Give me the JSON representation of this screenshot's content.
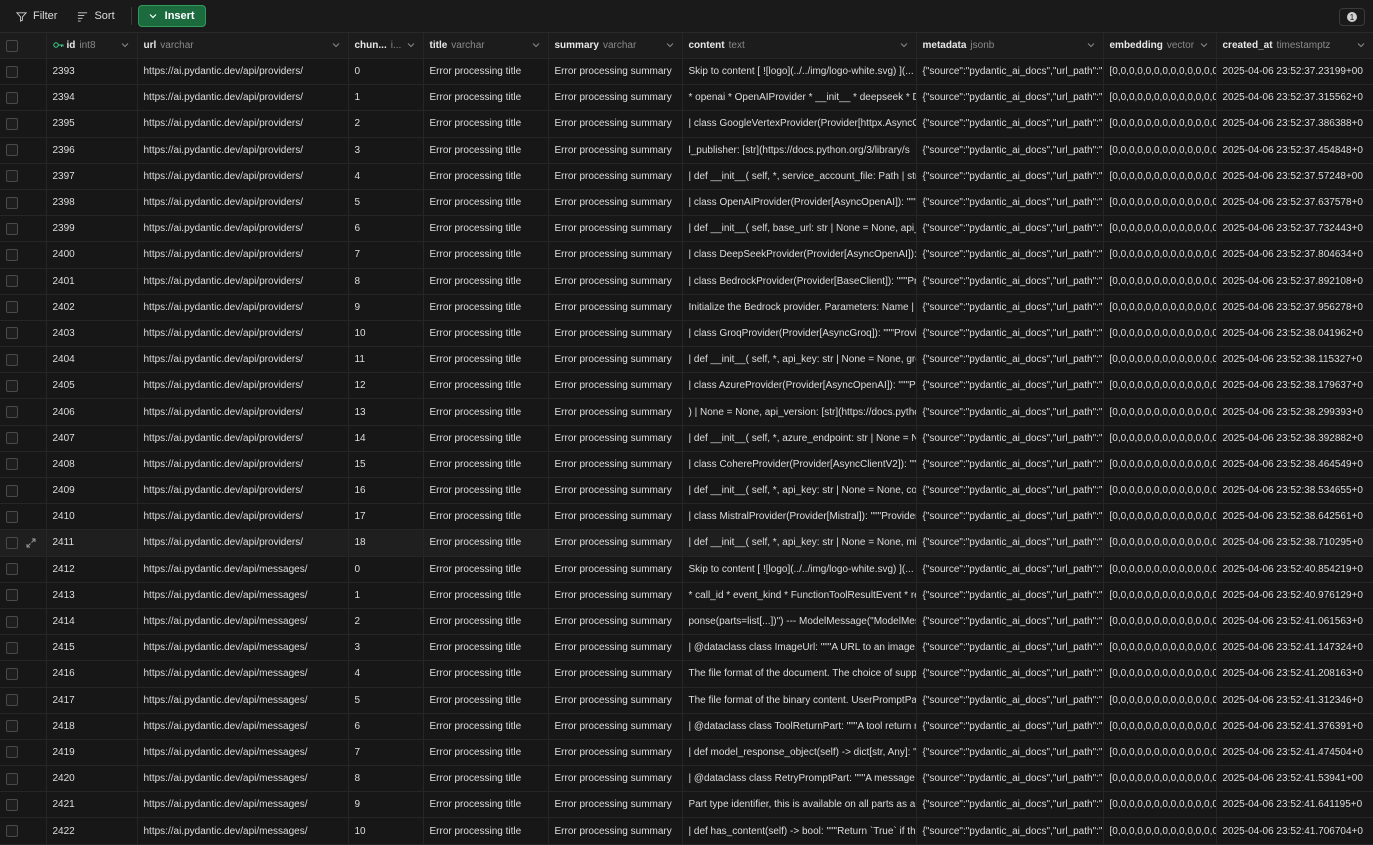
{
  "toolbar": {
    "filter_label": "Filter",
    "sort_label": "Sort",
    "insert_label": "Insert",
    "badge_count": "1"
  },
  "columns": [
    {
      "name": "id",
      "type": "int8"
    },
    {
      "name": "url",
      "type": "varchar"
    },
    {
      "name": "chun...",
      "type": "i..."
    },
    {
      "name": "title",
      "type": "varchar"
    },
    {
      "name": "summary",
      "type": "varchar"
    },
    {
      "name": "content",
      "type": "text"
    },
    {
      "name": "metadata",
      "type": "jsonb"
    },
    {
      "name": "embedding",
      "type": "vector"
    },
    {
      "name": "created_at",
      "type": "timestamptz"
    }
  ],
  "rows": [
    {
      "id": "2393",
      "url": "https://ai.pydantic.dev/api/providers/",
      "chunk": "0",
      "title": "Error processing title",
      "summary": "Error processing summary",
      "content": "Skip to content [ ![logo](../../img/logo-white.svg) ](...",
      "metadata": "{\"source\":\"pydantic_ai_docs\",\"url_path\":\"",
      "embedding": "[0,0,0,0,0,0,0,0,0,0,0,0,0,0,0",
      "created_at": "2025-04-06 23:52:37.23199+00"
    },
    {
      "id": "2394",
      "url": "https://ai.pydantic.dev/api/providers/",
      "chunk": "1",
      "title": "Error processing title",
      "summary": "Error processing summary",
      "content": "* openai * OpenAIProvider * __init__ * deepseek * D",
      "metadata": "{\"source\":\"pydantic_ai_docs\",\"url_path\":\"",
      "embedding": "[0,0,0,0,0,0,0,0,0,0,0,0,0,0,0",
      "created_at": "2025-04-06 23:52:37.315562+0"
    },
    {
      "id": "2395",
      "url": "https://ai.pydantic.dev/api/providers/",
      "chunk": "2",
      "title": "Error processing title",
      "summary": "Error processing summary",
      "content": "| class GoogleVertexProvider(Provider[httpx.AsyncC",
      "metadata": "{\"source\":\"pydantic_ai_docs\",\"url_path\":\"",
      "embedding": "[0,0,0,0,0,0,0,0,0,0,0,0,0,0,0",
      "created_at": "2025-04-06 23:52:37.386388+0"
    },
    {
      "id": "2396",
      "url": "https://ai.pydantic.dev/api/providers/",
      "chunk": "3",
      "title": "Error processing title",
      "summary": "Error processing summary",
      "content": "l_publisher: [str](https://docs.python.org/3/library/s",
      "metadata": "{\"source\":\"pydantic_ai_docs\",\"url_path\":\"",
      "embedding": "[0,0,0,0,0,0,0,0,0,0,0,0,0,0,0",
      "created_at": "2025-04-06 23:52:37.454848+0"
    },
    {
      "id": "2397",
      "url": "https://ai.pydantic.dev/api/providers/",
      "chunk": "4",
      "title": "Error processing title",
      "summary": "Error processing summary",
      "content": "| def __init__( self, *, service_account_file: Path | str",
      "metadata": "{\"source\":\"pydantic_ai_docs\",\"url_path\":\"",
      "embedding": "[0,0,0,0,0,0,0,0,0,0,0,0,0,0,0",
      "created_at": "2025-04-06 23:52:37.57248+00"
    },
    {
      "id": "2398",
      "url": "https://ai.pydantic.dev/api/providers/",
      "chunk": "5",
      "title": "Error processing title",
      "summary": "Error processing summary",
      "content": "| class OpenAIProvider(Provider[AsyncOpenAI]): \"\"\"P",
      "metadata": "{\"source\":\"pydantic_ai_docs\",\"url_path\":\"",
      "embedding": "[0,0,0,0,0,0,0,0,0,0,0,0,0,0,0",
      "created_at": "2025-04-06 23:52:37.637578+0"
    },
    {
      "id": "2399",
      "url": "https://ai.pydantic.dev/api/providers/",
      "chunk": "6",
      "title": "Error processing title",
      "summary": "Error processing summary",
      "content": "| def __init__( self, base_url: str | None = None, api_",
      "metadata": "{\"source\":\"pydantic_ai_docs\",\"url_path\":\"",
      "embedding": "[0,0,0,0,0,0,0,0,0,0,0,0,0,0,0",
      "created_at": "2025-04-06 23:52:37.732443+0"
    },
    {
      "id": "2400",
      "url": "https://ai.pydantic.dev/api/providers/",
      "chunk": "7",
      "title": "Error processing title",
      "summary": "Error processing summary",
      "content": "| class DeepSeekProvider(Provider[AsyncOpenAI]): \"",
      "metadata": "{\"source\":\"pydantic_ai_docs\",\"url_path\":\"",
      "embedding": "[0,0,0,0,0,0,0,0,0,0,0,0,0,0,0",
      "created_at": "2025-04-06 23:52:37.804634+0"
    },
    {
      "id": "2401",
      "url": "https://ai.pydantic.dev/api/providers/",
      "chunk": "8",
      "title": "Error processing title",
      "summary": "Error processing summary",
      "content": "| class BedrockProvider(Provider[BaseClient]): \"\"\"Pro",
      "metadata": "{\"source\":\"pydantic_ai_docs\",\"url_path\":\"",
      "embedding": "[0,0,0,0,0,0,0,0,0,0,0,0,0,0,0",
      "created_at": "2025-04-06 23:52:37.892108+0"
    },
    {
      "id": "2402",
      "url": "https://ai.pydantic.dev/api/providers/",
      "chunk": "9",
      "title": "Error processing title",
      "summary": "Error processing summary",
      "content": "Initialize the Bedrock provider. Parameters: Name | T",
      "metadata": "{\"source\":\"pydantic_ai_docs\",\"url_path\":\"",
      "embedding": "[0,0,0,0,0,0,0,0,0,0,0,0,0,0,0",
      "created_at": "2025-04-06 23:52:37.956278+0"
    },
    {
      "id": "2403",
      "url": "https://ai.pydantic.dev/api/providers/",
      "chunk": "10",
      "title": "Error processing title",
      "summary": "Error processing summary",
      "content": "| class GroqProvider(Provider[AsyncGroq]): \"\"\"Provic",
      "metadata": "{\"source\":\"pydantic_ai_docs\",\"url_path\":\"",
      "embedding": "[0,0,0,0,0,0,0,0,0,0,0,0,0,0,0",
      "created_at": "2025-04-06 23:52:38.041962+0"
    },
    {
      "id": "2404",
      "url": "https://ai.pydantic.dev/api/providers/",
      "chunk": "11",
      "title": "Error processing title",
      "summary": "Error processing summary",
      "content": "| def __init__( self, *, api_key: str | None = None, gro",
      "metadata": "{\"source\":\"pydantic_ai_docs\",\"url_path\":\"",
      "embedding": "[0,0,0,0,0,0,0,0,0,0,0,0,0,0,0",
      "created_at": "2025-04-06 23:52:38.115327+0"
    },
    {
      "id": "2405",
      "url": "https://ai.pydantic.dev/api/providers/",
      "chunk": "12",
      "title": "Error processing title",
      "summary": "Error processing summary",
      "content": "| class AzureProvider(Provider[AsyncOpenAI]): \"\"\"Pro",
      "metadata": "{\"source\":\"pydantic_ai_docs\",\"url_path\":\"",
      "embedding": "[0,0,0,0,0,0,0,0,0,0,0,0,0,0,0",
      "created_at": "2025-04-06 23:52:38.179637+0"
    },
    {
      "id": "2406",
      "url": "https://ai.pydantic.dev/api/providers/",
      "chunk": "13",
      "title": "Error processing title",
      "summary": "Error processing summary",
      "content": ") | None = None, api_version: [str](https://docs.pytho",
      "metadata": "{\"source\":\"pydantic_ai_docs\",\"url_path\":\"",
      "embedding": "[0,0,0,0,0,0,0,0,0,0,0,0,0,0,0",
      "created_at": "2025-04-06 23:52:38.299393+0"
    },
    {
      "id": "2407",
      "url": "https://ai.pydantic.dev/api/providers/",
      "chunk": "14",
      "title": "Error processing title",
      "summary": "Error processing summary",
      "content": "| def __init__( self, *, azure_endpoint: str | None = N",
      "metadata": "{\"source\":\"pydantic_ai_docs\",\"url_path\":\"",
      "embedding": "[0,0,0,0,0,0,0,0,0,0,0,0,0,0,0",
      "created_at": "2025-04-06 23:52:38.392882+0"
    },
    {
      "id": "2408",
      "url": "https://ai.pydantic.dev/api/providers/",
      "chunk": "15",
      "title": "Error processing title",
      "summary": "Error processing summary",
      "content": "| class CohereProvider(Provider[AsyncClientV2]): \"\"\"",
      "metadata": "{\"source\":\"pydantic_ai_docs\",\"url_path\":\"",
      "embedding": "[0,0,0,0,0,0,0,0,0,0,0,0,0,0,0",
      "created_at": "2025-04-06 23:52:38.464549+0"
    },
    {
      "id": "2409",
      "url": "https://ai.pydantic.dev/api/providers/",
      "chunk": "16",
      "title": "Error processing title",
      "summary": "Error processing summary",
      "content": "| def __init__( self, *, api_key: str | None = None, coh",
      "metadata": "{\"source\":\"pydantic_ai_docs\",\"url_path\":\"",
      "embedding": "[0,0,0,0,0,0,0,0,0,0,0,0,0,0,0",
      "created_at": "2025-04-06 23:52:38.534655+0"
    },
    {
      "id": "2410",
      "url": "https://ai.pydantic.dev/api/providers/",
      "chunk": "17",
      "title": "Error processing title",
      "summary": "Error processing summary",
      "content": "| class MistralProvider(Provider[Mistral]): \"\"\"Provider",
      "metadata": "{\"source\":\"pydantic_ai_docs\",\"url_path\":\"",
      "embedding": "[0,0,0,0,0,0,0,0,0,0,0,0,0,0,0",
      "created_at": "2025-04-06 23:52:38.642561+0"
    },
    {
      "id": "2411",
      "url": "https://ai.pydantic.dev/api/providers/",
      "chunk": "18",
      "title": "Error processing title",
      "summary": "Error processing summary",
      "content": "| def __init__( self, *, api_key: str | None = None, mis",
      "metadata": "{\"source\":\"pydantic_ai_docs\",\"url_path\":\"",
      "embedding": "[0,0,0,0,0,0,0,0,0,0,0,0,0,0,0",
      "created_at": "2025-04-06 23:52:38.710295+0"
    },
    {
      "id": "2412",
      "url": "https://ai.pydantic.dev/api/messages/",
      "chunk": "0",
      "title": "Error processing title",
      "summary": "Error processing summary",
      "content": "Skip to content [ ![logo](../../img/logo-white.svg) ](...",
      "metadata": "{\"source\":\"pydantic_ai_docs\",\"url_path\":\"",
      "embedding": "[0,0,0,0,0,0,0,0,0,0,0,0,0,0,0",
      "created_at": "2025-04-06 23:52:40.854219+0"
    },
    {
      "id": "2413",
      "url": "https://ai.pydantic.dev/api/messages/",
      "chunk": "1",
      "title": "Error processing title",
      "summary": "Error processing summary",
      "content": "* call_id * event_kind * FunctionToolResultEvent * re",
      "metadata": "{\"source\":\"pydantic_ai_docs\",\"url_path\":\"",
      "embedding": "[0,0,0,0,0,0,0,0,0,0,0,0,0,0,0",
      "created_at": "2025-04-06 23:52:40.976129+0"
    },
    {
      "id": "2414",
      "url": "https://ai.pydantic.dev/api/messages/",
      "chunk": "2",
      "title": "Error processing title",
      "summary": "Error processing summary",
      "content": "ponse(parts=list[...])\") --- ModelMessage(\"ModelMes",
      "metadata": "{\"source\":\"pydantic_ai_docs\",\"url_path\":\"",
      "embedding": "[0,0,0,0,0,0,0,0,0,0,0,0,0,0,0",
      "created_at": "2025-04-06 23:52:41.061563+0"
    },
    {
      "id": "2415",
      "url": "https://ai.pydantic.dev/api/messages/",
      "chunk": "3",
      "title": "Error processing title",
      "summary": "Error processing summary",
      "content": "| @dataclass class ImageUrl: \"\"\"A URL to an image.\"",
      "metadata": "{\"source\":\"pydantic_ai_docs\",\"url_path\":\"",
      "embedding": "[0,0,0,0,0,0,0,0,0,0,0,0,0,0,0",
      "created_at": "2025-04-06 23:52:41.147324+0"
    },
    {
      "id": "2416",
      "url": "https://ai.pydantic.dev/api/messages/",
      "chunk": "4",
      "title": "Error processing title",
      "summary": "Error processing summary",
      "content": "The file format of the document. The choice of supp",
      "metadata": "{\"source\":\"pydantic_ai_docs\",\"url_path\":\"",
      "embedding": "[0,0,0,0,0,0,0,0,0,0,0,0,0,0,0",
      "created_at": "2025-04-06 23:52:41.208163+0"
    },
    {
      "id": "2417",
      "url": "https://ai.pydantic.dev/api/messages/",
      "chunk": "5",
      "title": "Error processing title",
      "summary": "Error processing summary",
      "content": "The file format of the binary content. UserPromptPa",
      "metadata": "{\"source\":\"pydantic_ai_docs\",\"url_path\":\"",
      "embedding": "[0,0,0,0,0,0,0,0,0,0,0,0,0,0,0",
      "created_at": "2025-04-06 23:52:41.312346+0"
    },
    {
      "id": "2418",
      "url": "https://ai.pydantic.dev/api/messages/",
      "chunk": "6",
      "title": "Error processing title",
      "summary": "Error processing summary",
      "content": "| @dataclass class ToolReturnPart: \"\"\"A tool return m",
      "metadata": "{\"source\":\"pydantic_ai_docs\",\"url_path\":\"",
      "embedding": "[0,0,0,0,0,0,0,0,0,0,0,0,0,0,0",
      "created_at": "2025-04-06 23:52:41.376391+0"
    },
    {
      "id": "2419",
      "url": "https://ai.pydantic.dev/api/messages/",
      "chunk": "7",
      "title": "Error processing title",
      "summary": "Error processing summary",
      "content": "| def model_response_object(self) -> dict[str, Any]: \"",
      "metadata": "{\"source\":\"pydantic_ai_docs\",\"url_path\":\"",
      "embedding": "[0,0,0,0,0,0,0,0,0,0,0,0,0,0,0",
      "created_at": "2025-04-06 23:52:41.474504+0"
    },
    {
      "id": "2420",
      "url": "https://ai.pydantic.dev/api/messages/",
      "chunk": "8",
      "title": "Error processing title",
      "summary": "Error processing summary",
      "content": "| @dataclass class RetryPromptPart: \"\"\"A message ba",
      "metadata": "{\"source\":\"pydantic_ai_docs\",\"url_path\":\"",
      "embedding": "[0,0,0,0,0,0,0,0,0,0,0,0,0,0,0",
      "created_at": "2025-04-06 23:52:41.53941+00"
    },
    {
      "id": "2421",
      "url": "https://ai.pydantic.dev/api/messages/",
      "chunk": "9",
      "title": "Error processing title",
      "summary": "Error processing summary",
      "content": "Part type identifier, this is available on all parts as a",
      "metadata": "{\"source\":\"pydantic_ai_docs\",\"url_path\":\"",
      "embedding": "[0,0,0,0,0,0,0,0,0,0,0,0,0,0,0",
      "created_at": "2025-04-06 23:52:41.641195+0"
    },
    {
      "id": "2422",
      "url": "https://ai.pydantic.dev/api/messages/",
      "chunk": "10",
      "title": "Error processing title",
      "summary": "Error processing summary",
      "content": "| def has_content(self) -> bool: \"\"\"Return `True` if the",
      "metadata": "{\"source\":\"pydantic_ai_docs\",\"url_path\":\"",
      "embedding": "[0,0,0,0,0,0,0,0,0,0,0,0,0,0,0",
      "created_at": "2025-04-06 23:52:41.706704+0"
    }
  ],
  "hovered_row_id": "2411"
}
